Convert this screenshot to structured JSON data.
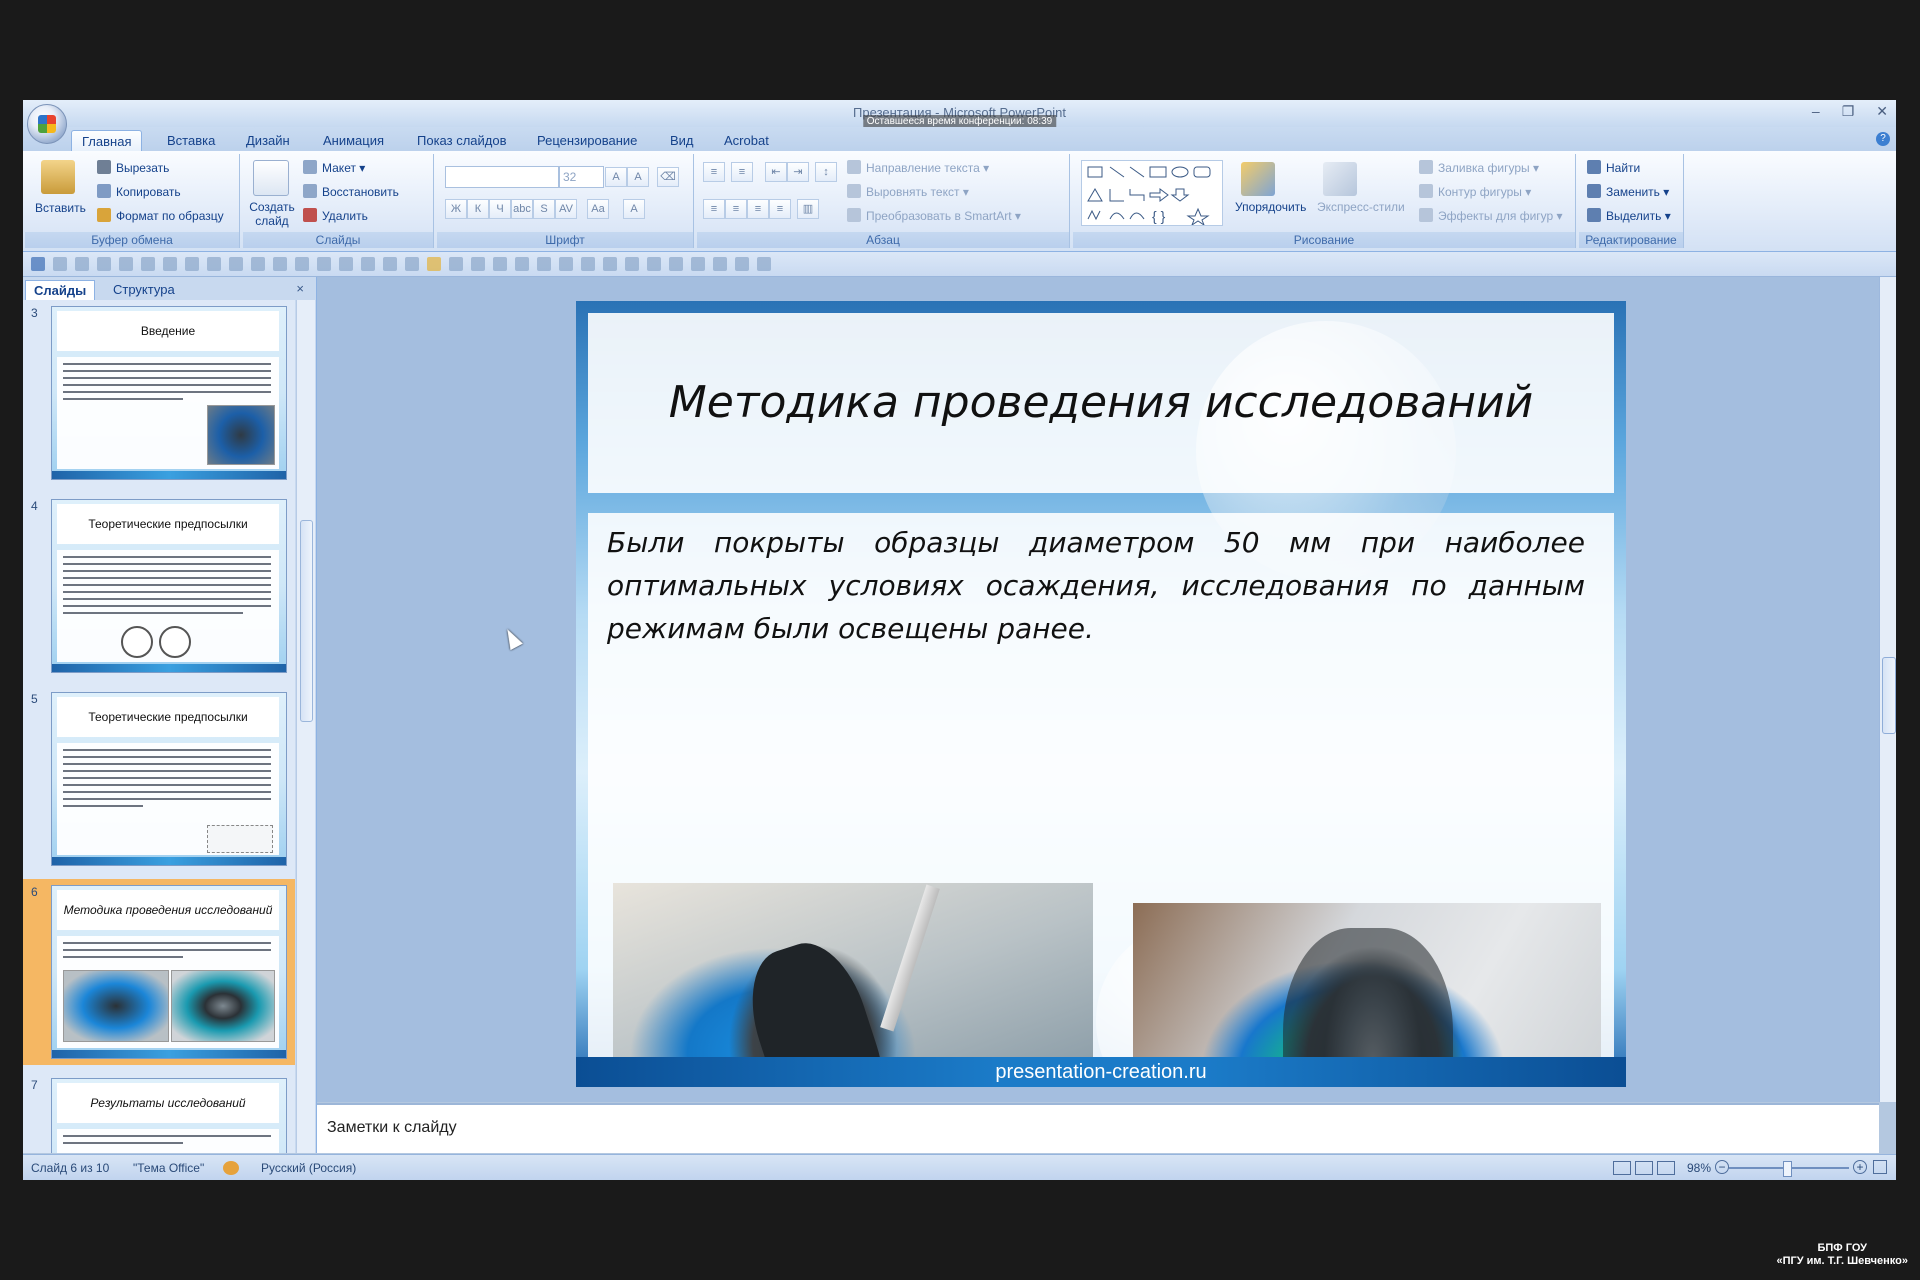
{
  "window": {
    "title": "Презентация - Microsoft PowerPoint",
    "conference_timer": "Оставшееся время конференции: 08:39",
    "minimize": "–",
    "restore": "❐",
    "close": "✕"
  },
  "tabs": [
    "Главная",
    "Вставка",
    "Дизайн",
    "Анимация",
    "Показ слайдов",
    "Рецензирование",
    "Вид",
    "Acrobat"
  ],
  "ribbon": {
    "clipboard": {
      "label": "Буфер обмена",
      "paste": "Вставить",
      "cut": "Вырезать",
      "copy": "Копировать",
      "format_painter": "Формат по образцу"
    },
    "slides": {
      "label": "Слайды",
      "new_slide": "Создать слайд",
      "layout": "Макет",
      "reset": "Восстановить",
      "delete": "Удалить"
    },
    "font": {
      "label": "Шрифт",
      "size": "32"
    },
    "paragraph": {
      "label": "Абзац",
      "text_direction": "Направление текста",
      "align_text": "Выровнять текст",
      "smartart": "Преобразовать в SmartArt"
    },
    "drawing": {
      "label": "Рисование",
      "arrange": "Упорядочить",
      "quick_styles": "Экспресс-стили",
      "shape_fill": "Заливка фигуры",
      "shape_outline": "Контур фигуры",
      "shape_effects": "Эффекты для фигур"
    },
    "editing": {
      "label": "Редактирование",
      "find": "Найти",
      "replace": "Заменить",
      "select": "Выделить"
    }
  },
  "left_panel": {
    "tab_slides": "Слайды",
    "tab_outline": "Структура",
    "close": "×",
    "thumbnails": [
      {
        "num": "3",
        "title": "Введение"
      },
      {
        "num": "4",
        "title": "Теоретические предпосылки"
      },
      {
        "num": "5",
        "title": "Теоретические предпосылки"
      },
      {
        "num": "6",
        "title": "Методика проведения исследований"
      },
      {
        "num": "7",
        "title": "Результаты исследований"
      }
    ]
  },
  "slide": {
    "title": "Методика проведения исследований",
    "body": "Были покрыты образцы диаметром 50 мм при наиболее оптимальных условиях осаждения, исследования по данным режимам были освещены ранее.",
    "footer": "presentation-creation.ru"
  },
  "notes": {
    "placeholder": "Заметки к слайду"
  },
  "status": {
    "slide_info": "Слайд 6 из 10",
    "theme": "\"Тема Office\"",
    "language": "Русский (Россия)",
    "zoom": "98%"
  },
  "watermark": {
    "line1": "БПФ ГОУ",
    "line2": "«ПГУ им. Т.Г. Шевченко»"
  }
}
